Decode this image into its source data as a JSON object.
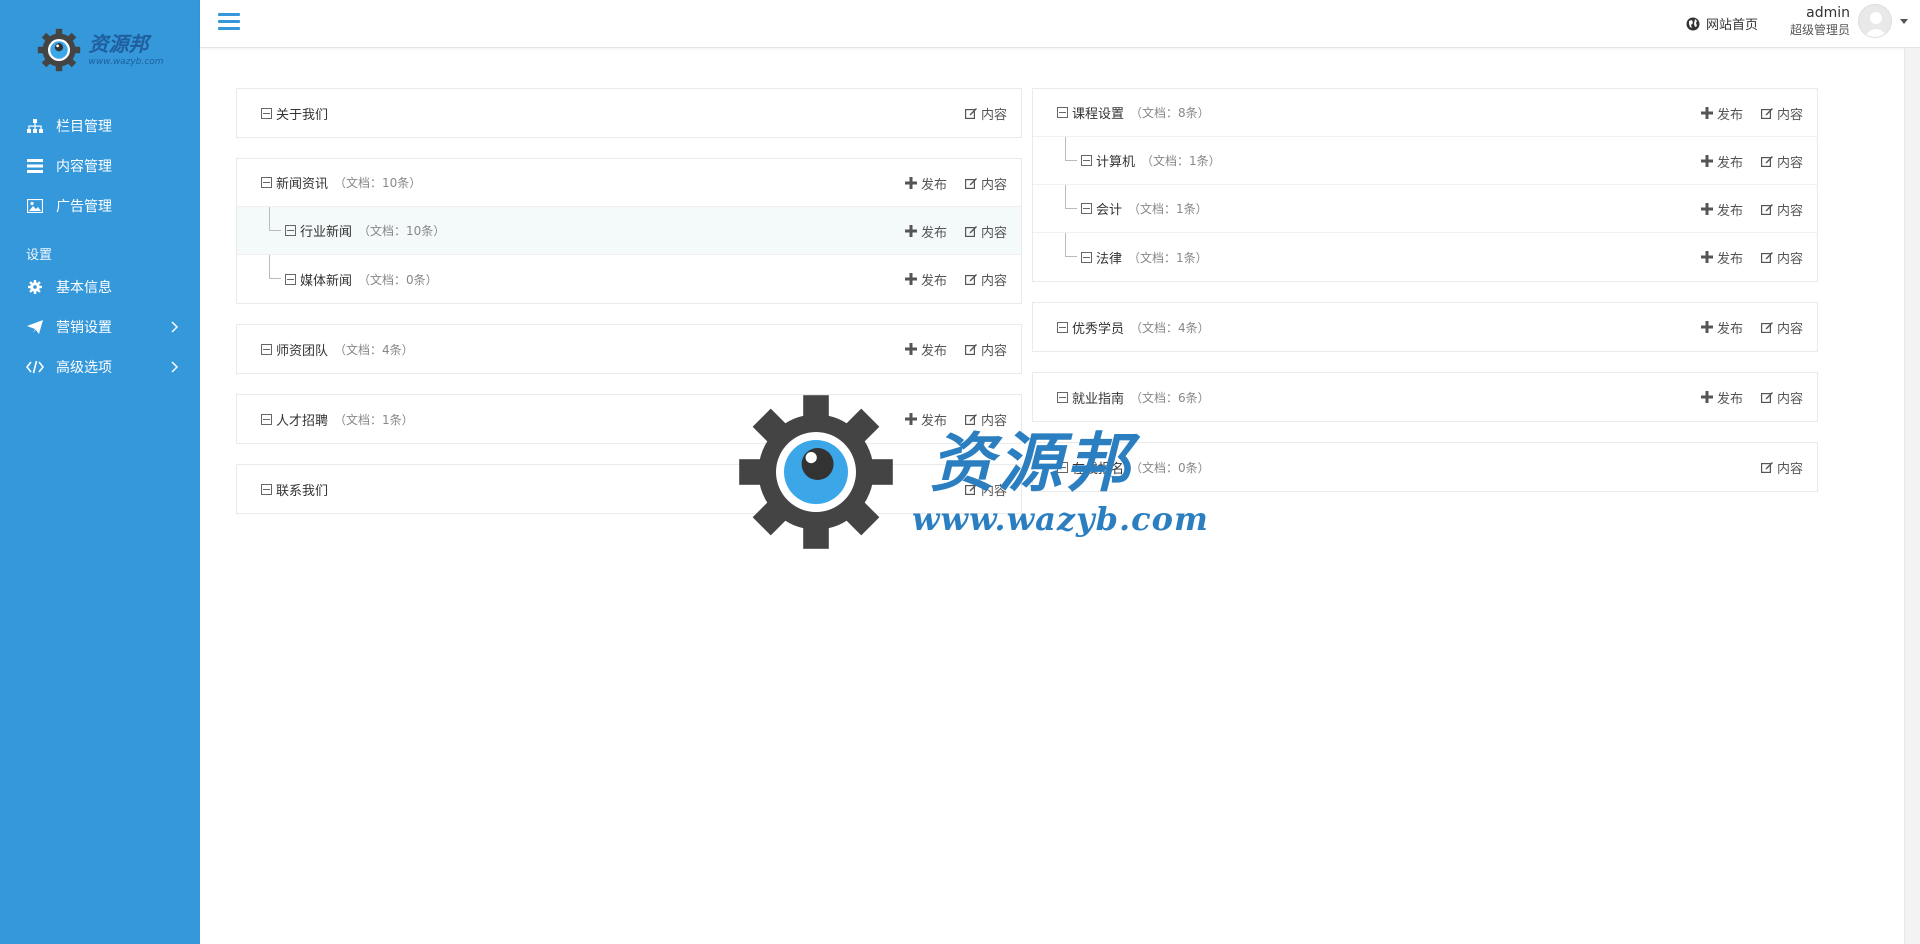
{
  "brand": {
    "name": "资源邦",
    "url": "www.wazyb.com"
  },
  "sidebar": {
    "items": [
      {
        "label": "栏目管理",
        "icon": "sitemap-icon"
      },
      {
        "label": "内容管理",
        "icon": "list-icon"
      },
      {
        "label": "广告管理",
        "icon": "image-icon"
      }
    ],
    "section_label": "设置",
    "settings": [
      {
        "label": "基本信息",
        "icon": "gear-icon"
      },
      {
        "label": "营销设置",
        "icon": "send-icon"
      },
      {
        "label": "高级选项",
        "icon": "code-icon"
      }
    ]
  },
  "header": {
    "site_link": "网站首页",
    "user_name": "admin",
    "user_role": "超级管理员"
  },
  "actions": {
    "publish": "发布",
    "content": "内容"
  },
  "left_cards": [
    {
      "rows": [
        {
          "title": "关于我们",
          "count": ""
        }
      ]
    },
    {
      "rows": [
        {
          "title": "新闻资讯",
          "count": "（文档：10条）"
        },
        {
          "title": "行业新闻",
          "count": "（文档：10条）"
        },
        {
          "title": "媒体新闻",
          "count": "（文档：0条）"
        }
      ]
    },
    {
      "rows": [
        {
          "title": "师资团队",
          "count": "（文档：4条）"
        }
      ]
    },
    {
      "rows": [
        {
          "title": "人才招聘",
          "count": "（文档：1条）"
        }
      ]
    },
    {
      "rows": [
        {
          "title": "联系我们",
          "count": ""
        }
      ]
    }
  ],
  "right_cards": [
    {
      "rows": [
        {
          "title": "课程设置",
          "count": "（文档：8条）"
        },
        {
          "title": "计算机",
          "count": "（文档：1条）"
        },
        {
          "title": "会计",
          "count": "（文档：1条）"
        },
        {
          "title": "法律",
          "count": "（文档：1条）"
        }
      ]
    },
    {
      "rows": [
        {
          "title": "优秀学员",
          "count": "（文档：4条）"
        }
      ]
    },
    {
      "rows": [
        {
          "title": "就业指南",
          "count": "（文档：6条）"
        }
      ]
    },
    {
      "rows": [
        {
          "title": "在线报名",
          "count": "（文档：0条）"
        }
      ]
    }
  ],
  "watermark": {
    "title": "资源邦",
    "url": "www.wazyb.com"
  },
  "colors": {
    "sidebar": "#3498db",
    "accent": "#3498db",
    "highlight_row": "#f3faf9"
  }
}
